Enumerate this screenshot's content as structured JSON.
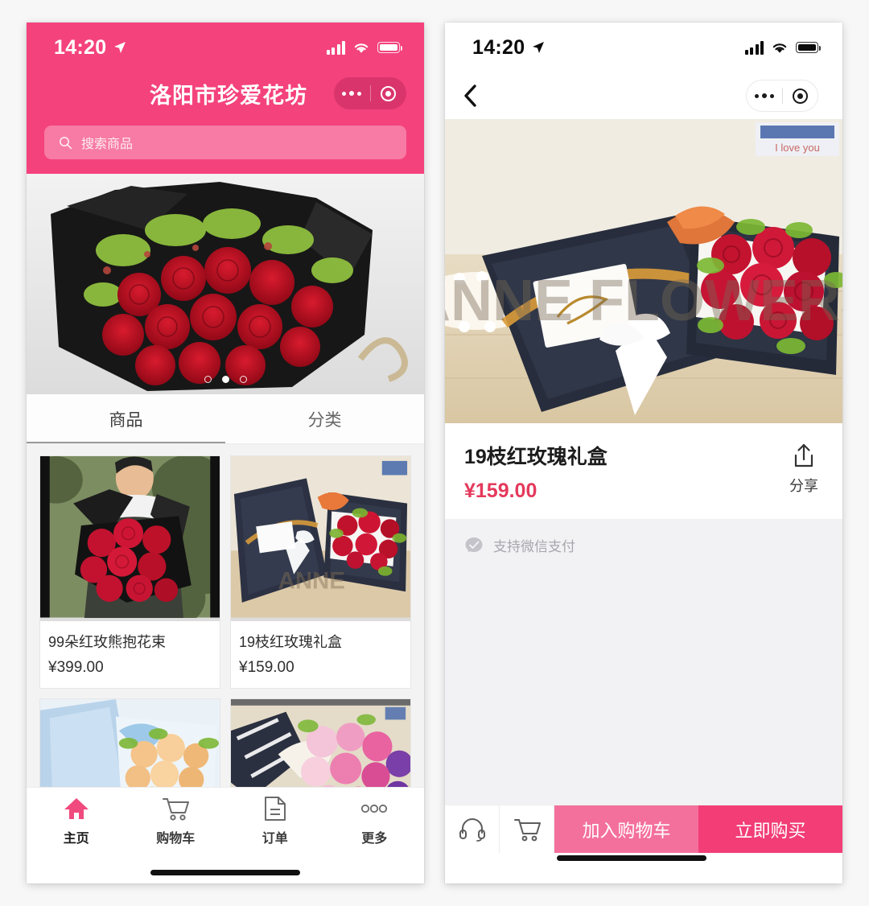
{
  "status_bar": {
    "time": "14:20",
    "location_icon": "location-arrow-icon",
    "signal_icon": "cellular-signal-icon",
    "wifi_icon": "wifi-icon",
    "battery_icon": "battery-full-icon"
  },
  "colors": {
    "brand_pink": "#f4427d",
    "price_red": "#e4395c",
    "cart_button": "#f4709c",
    "buy_button": "#f23d77",
    "pay_strip_bg": "#f2f2f5"
  },
  "left_phone": {
    "header": {
      "title": "洛阳市珍爱花坊",
      "more_icon": "ellipsis-icon",
      "target_icon": "target-circle-icon"
    },
    "search": {
      "icon": "search-icon",
      "placeholder": "搜索商品"
    },
    "carousel": {
      "slide_count": 3,
      "active_index": 1,
      "alt": "红玫瑰花束轮播图"
    },
    "tabs": [
      {
        "label": "商品",
        "active": true
      },
      {
        "label": "分类",
        "active": false
      }
    ],
    "products": [
      {
        "name": "99朵红玫熊抱花束",
        "price": "¥399.00",
        "image": "red-rose-bouquet-held"
      },
      {
        "name": "19枝红玫瑰礼盒",
        "price": "¥159.00",
        "image": "red-rose-gift-box"
      },
      {
        "name": "",
        "price": "",
        "image": "champagne-rose-box"
      },
      {
        "name": "",
        "price": "",
        "image": "pink-purple-bouquet"
      }
    ],
    "tabbar": [
      {
        "label": "主页",
        "icon": "home-icon",
        "active": true
      },
      {
        "label": "购物车",
        "icon": "shopping-cart-icon",
        "active": false
      },
      {
        "label": "订单",
        "icon": "order-document-icon",
        "active": false
      },
      {
        "label": "更多",
        "icon": "more-dots-icon",
        "active": false
      }
    ]
  },
  "right_phone": {
    "nav": {
      "back_icon": "back-chevron-icon",
      "more_icon": "ellipsis-icon",
      "target_icon": "target-circle-icon"
    },
    "hero": {
      "watermark": "ANNE FLOWERS",
      "badge_text": "I love you",
      "alt": "19枝红玫瑰礼盒主图"
    },
    "detail": {
      "title": "19枝红玫瑰礼盒",
      "price": "¥159.00",
      "share_label": "分享",
      "share_icon": "share-upload-icon"
    },
    "payment": {
      "icon": "wechat-pay-icon",
      "text": "支持微信支付"
    },
    "actions": {
      "service_icon": "headset-service-icon",
      "cart_icon": "shopping-cart-icon",
      "add_to_cart_label": "加入购物车",
      "buy_now_label": "立即购买"
    }
  }
}
